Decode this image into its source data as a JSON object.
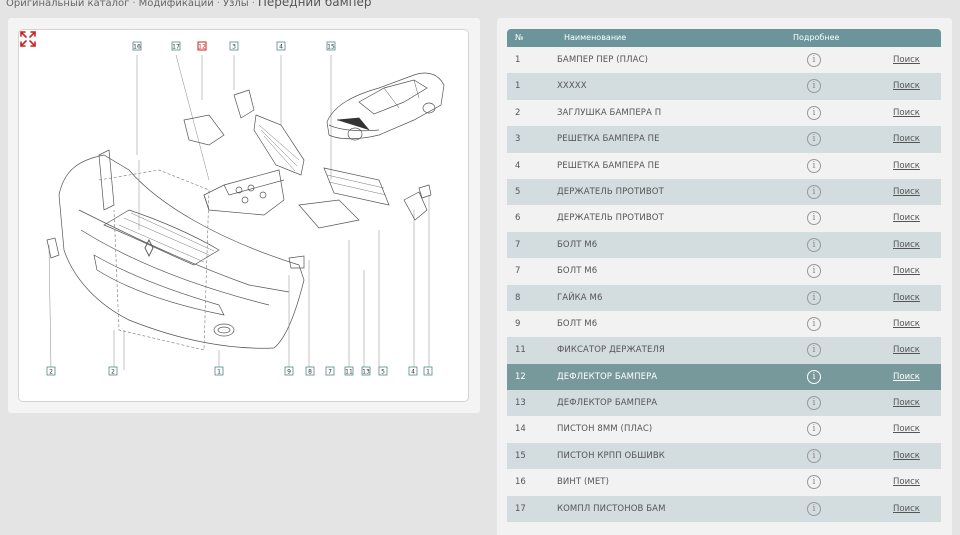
{
  "breadcrumb": {
    "items": [
      "Оригинальный каталог",
      "Модификации",
      "Узлы"
    ],
    "separator": "·",
    "current": "Передний бампер"
  },
  "diagram": {
    "callouts_top": [
      "16",
      "17",
      "12",
      "3",
      "4",
      "15"
    ],
    "callouts_bottom": [
      "2",
      "2",
      "1",
      "9",
      "8",
      "7",
      "11",
      "13",
      "5",
      "4",
      "1"
    ],
    "highlighted_callout": "12",
    "expand_icon": "expand-arrows-icon"
  },
  "table": {
    "headers": {
      "num": "№",
      "name": "Наименование",
      "details": "Подробнее"
    },
    "search_label": "Поиск",
    "info_glyph": "i",
    "rows": [
      {
        "num": "1",
        "name": "БАМПЕР ПЕР (ПЛАС)"
      },
      {
        "num": "1",
        "name": "XXXXX"
      },
      {
        "num": "2",
        "name": "ЗАГЛУШКА БАМПЕРА П"
      },
      {
        "num": "3",
        "name": "РЕШЕТКА БАМПЕРА ПЕ"
      },
      {
        "num": "4",
        "name": "РЕШЕТКА БАМПЕРА ПЕ"
      },
      {
        "num": "5",
        "name": "ДЕРЖАТЕЛЬ ПРОТИВОТ"
      },
      {
        "num": "6",
        "name": "ДЕРЖАТЕЛЬ ПРОТИВОТ"
      },
      {
        "num": "7",
        "name": "БОЛТ М6"
      },
      {
        "num": "7",
        "name": "БОЛТ М6"
      },
      {
        "num": "8",
        "name": "ГАЙКА М6"
      },
      {
        "num": "9",
        "name": "БОЛТ М6"
      },
      {
        "num": "11",
        "name": "ФИКСАТОР ДЕРЖАТЕЛЯ"
      },
      {
        "num": "12",
        "name": "ДЕФЛЕКТОР БАМПЕРА",
        "selected": true
      },
      {
        "num": "13",
        "name": "ДЕФЛЕКТОР БАМПЕРА"
      },
      {
        "num": "14",
        "name": "ПИСТОН 8ММ (ПЛАС)"
      },
      {
        "num": "15",
        "name": "ПИСТОН КРПП ОБШИВК"
      },
      {
        "num": "16",
        "name": "ВИНТ (МЕТ)"
      },
      {
        "num": "17",
        "name": "КОМПЛ ПИСТОНОВ БАМ"
      }
    ]
  },
  "colors": {
    "header_bg": "#6b959a",
    "selected_row": "#78999c",
    "row_alt": "#d3dcdf",
    "highlight_callout": "#cc2222",
    "callout_border": "#3a7a7a"
  }
}
